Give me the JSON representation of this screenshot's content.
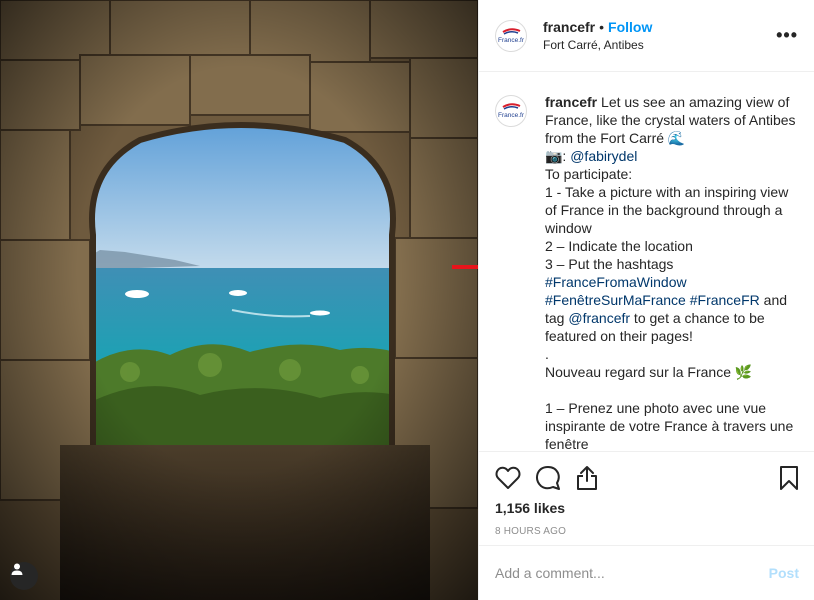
{
  "post": {
    "username": "francefr",
    "follow_label": "Follow",
    "dot": "•",
    "location": "Fort Carré, Antibes",
    "more_icon": "more-horizontal-icon",
    "avatar_text": "France.fr"
  },
  "caption": {
    "username": "francefr",
    "segments": [
      {
        "t": " Let us see an amazing view of France, like the crystal waters of Antibes from the Fort Carré 🌊\n📷: ",
        "link": false
      },
      {
        "t": "@fabirydel",
        "link": true
      },
      {
        "t": "\nTo participate:\n1 - Take a picture with an inspiring view of France in the background through a window\n2 – Indicate the location\n3 – Put the hashtags\n",
        "link": false
      },
      {
        "t": "#FranceFromaWindow",
        "link": true
      },
      {
        "t": "\n",
        "link": false
      },
      {
        "t": "#FenêtreSurMaFrance",
        "link": true
      },
      {
        "t": " ",
        "link": false
      },
      {
        "t": "#FranceFR",
        "link": true
      },
      {
        "t": " and tag ",
        "link": false
      },
      {
        "t": "@francefr",
        "link": true
      },
      {
        "t": " to get a chance to be featured on their pages!\n.\nNouveau regard sur la France 🌿\n\n1 – Prenez une photo avec une vue inspirante de votre France à travers une fenêtre",
        "link": false
      }
    ]
  },
  "actions": {
    "like_icon": "heart-icon",
    "comment_icon": "comment-icon",
    "share_icon": "share-icon",
    "save_icon": "bookmark-icon"
  },
  "likes": "1,156 likes",
  "timestamp": "8 HOURS AGO",
  "comment": {
    "placeholder": "Add a comment...",
    "post_label": "Post"
  },
  "colors": {
    "link": "#00376b",
    "follow": "#0095f6",
    "annotation_arrow": "#e8141b"
  }
}
